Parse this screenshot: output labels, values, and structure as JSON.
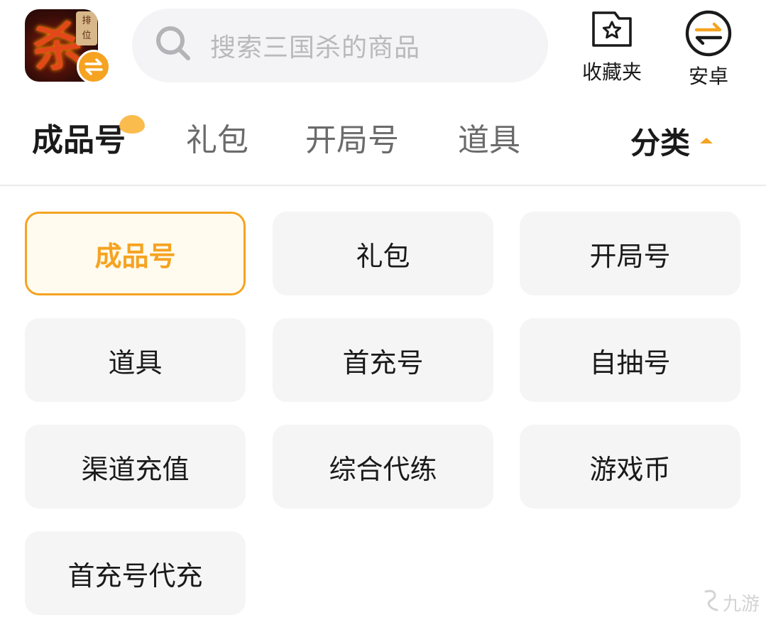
{
  "header": {
    "game_icon": {
      "name": "三国杀",
      "glyph": "杀",
      "rank_tag": "排\n位"
    },
    "search": {
      "placeholder": "搜索三国杀的商品"
    },
    "favorites_label": "收藏夹",
    "platform_label": "安卓"
  },
  "tabs": {
    "items": [
      {
        "label": "成品号",
        "active": true
      },
      {
        "label": "礼包",
        "active": false
      },
      {
        "label": "开局号",
        "active": false
      },
      {
        "label": "道具",
        "active": false
      }
    ],
    "category_label": "分类"
  },
  "categories": {
    "selected": "成品号",
    "items": [
      {
        "label": "成品号"
      },
      {
        "label": "礼包"
      },
      {
        "label": "开局号"
      },
      {
        "label": "道具"
      },
      {
        "label": "首充号"
      },
      {
        "label": "自抽号"
      },
      {
        "label": "渠道充值"
      },
      {
        "label": "综合代练"
      },
      {
        "label": "游戏币"
      },
      {
        "label": "首充号代充"
      }
    ]
  },
  "watermark": {
    "text": "九游"
  },
  "colors": {
    "accent": "#f5a321",
    "tile_bg": "#f5f5f5",
    "search_bg": "#f4f4f6"
  },
  "icons": {
    "search": "search-icon",
    "favorites": "star-folder-icon",
    "platform": "swap-arrows-icon",
    "caret": "caret-up-icon"
  }
}
